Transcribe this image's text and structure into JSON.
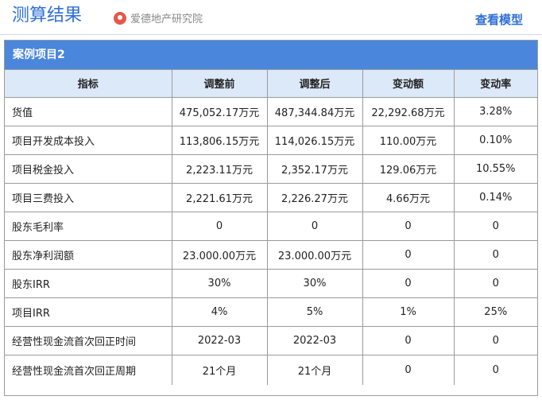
{
  "header": {
    "title": "测算结果",
    "brand_name": "爱德地产研究院",
    "brand_icon": "brand-logo-icon",
    "view_model_label": "查看模型",
    "accent_color": "#2f6fd6"
  },
  "panel": {
    "title": "案例项目2",
    "header_color": "#4a86dc",
    "columns": [
      "指标",
      "调整前",
      "调整后",
      "变动额",
      "变动率"
    ],
    "rows": [
      [
        "货值",
        "475,052.17万元",
        "487,344.84万元",
        "22,292.68万元",
        "3.28%"
      ],
      [
        "项目开发成本投入",
        "113,806.15万元",
        "114,026.15万元",
        "110.00万元",
        "0.10%"
      ],
      [
        "项目税金投入",
        "2,223.11万元",
        "2,352.17万元",
        "129.06万元",
        "10.55%"
      ],
      [
        "项目三费投入",
        "2,221.61万元",
        "2,226.27万元",
        "4.66万元",
        "0.14%"
      ],
      [
        "股东毛利率",
        "0",
        "0",
        "0",
        "0"
      ],
      [
        "股东净利润额",
        "23.000.00万元",
        "23.000.00万元",
        "0",
        "0"
      ],
      [
        "股东IRR",
        "30%",
        "30%",
        "0",
        "0"
      ],
      [
        "项目IRR",
        "4%",
        "5%",
        "1%",
        "25%"
      ],
      [
        "经营性现金流首次回正时间",
        "2022-03",
        "2022-03",
        "0",
        "0"
      ],
      [
        "经营性现金流首次回正周期",
        "21个月",
        "21个月",
        "0",
        "0"
      ]
    ]
  }
}
